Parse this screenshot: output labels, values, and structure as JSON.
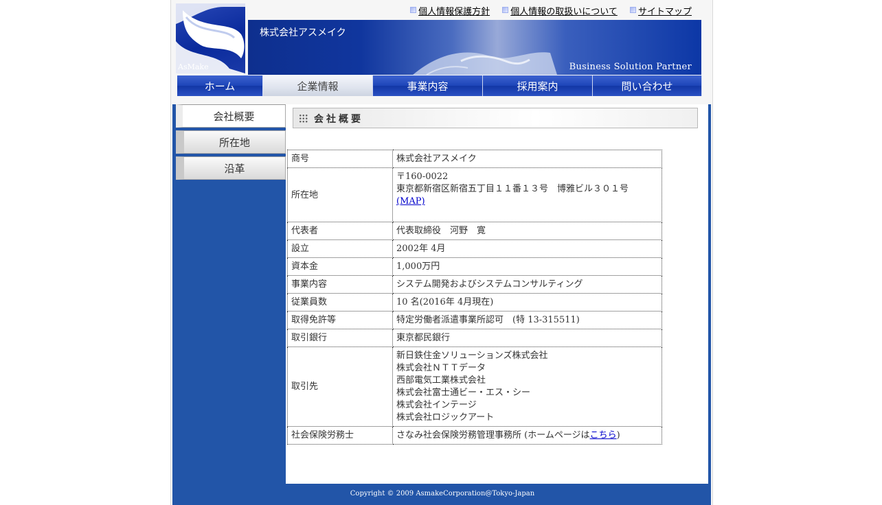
{
  "top_links": [
    {
      "label": "個人情報保護方針"
    },
    {
      "label": "個人情報の取扱いについて"
    },
    {
      "label": "サイトマップ"
    }
  ],
  "logo": {
    "text": "AsMake"
  },
  "banner": {
    "company": "株式会社アスメイク",
    "tagline": "Business Solution Partner"
  },
  "nav": [
    {
      "label": "ホーム"
    },
    {
      "label": "企業情報"
    },
    {
      "label": "事業内容"
    },
    {
      "label": "採用案内"
    },
    {
      "label": "問い合わせ"
    }
  ],
  "sidenav": [
    {
      "label": "会社概要"
    },
    {
      "label": "所在地"
    },
    {
      "label": "沿革"
    }
  ],
  "section_title": "会社概要",
  "info": {
    "name": {
      "label": "商号",
      "value": "株式会社アスメイク"
    },
    "address": {
      "label": "所在地",
      "postal": "〒160-0022",
      "line": "東京都新宿区新宿五丁目１１番１３号　博雅ビル３０１号",
      "map_link": "(MAP)"
    },
    "rep": {
      "label": "代表者",
      "value": "代表取締役　河野　寛"
    },
    "founded": {
      "label": "設立",
      "value": "2002年 4月"
    },
    "capital": {
      "label": "資本金",
      "value": "1,000万円"
    },
    "business": {
      "label": "事業内容",
      "value": "システム開発およびシステムコンサルティング"
    },
    "employees": {
      "label": "従業員数",
      "value": "10 名(2016年 4月現在)"
    },
    "license": {
      "label": "取得免許等",
      "value": "特定労働者派遣事業所認可　(特 13-315511)"
    },
    "bank": {
      "label": "取引銀行",
      "value": "東京都民銀行"
    },
    "clients": {
      "label": "取引先",
      "items": [
        "新日鉄住金ソリューションズ株式会社",
        "株式会社ＮＴＴデータ",
        "西部電気工業株式会社",
        "株式会社富士通ビー・エス・シー",
        "株式会社インテージ",
        "株式会社ロジックアート"
      ]
    },
    "sharoushi": {
      "label": "社会保険労務士",
      "value_prefix": "さなみ社会保険労務管理事務所 (ホームページは",
      "link": "こちら",
      "value_suffix": ")"
    }
  },
  "footer": "Copyright © 2009 AsmakeCorporation@Tokyo-Japan"
}
